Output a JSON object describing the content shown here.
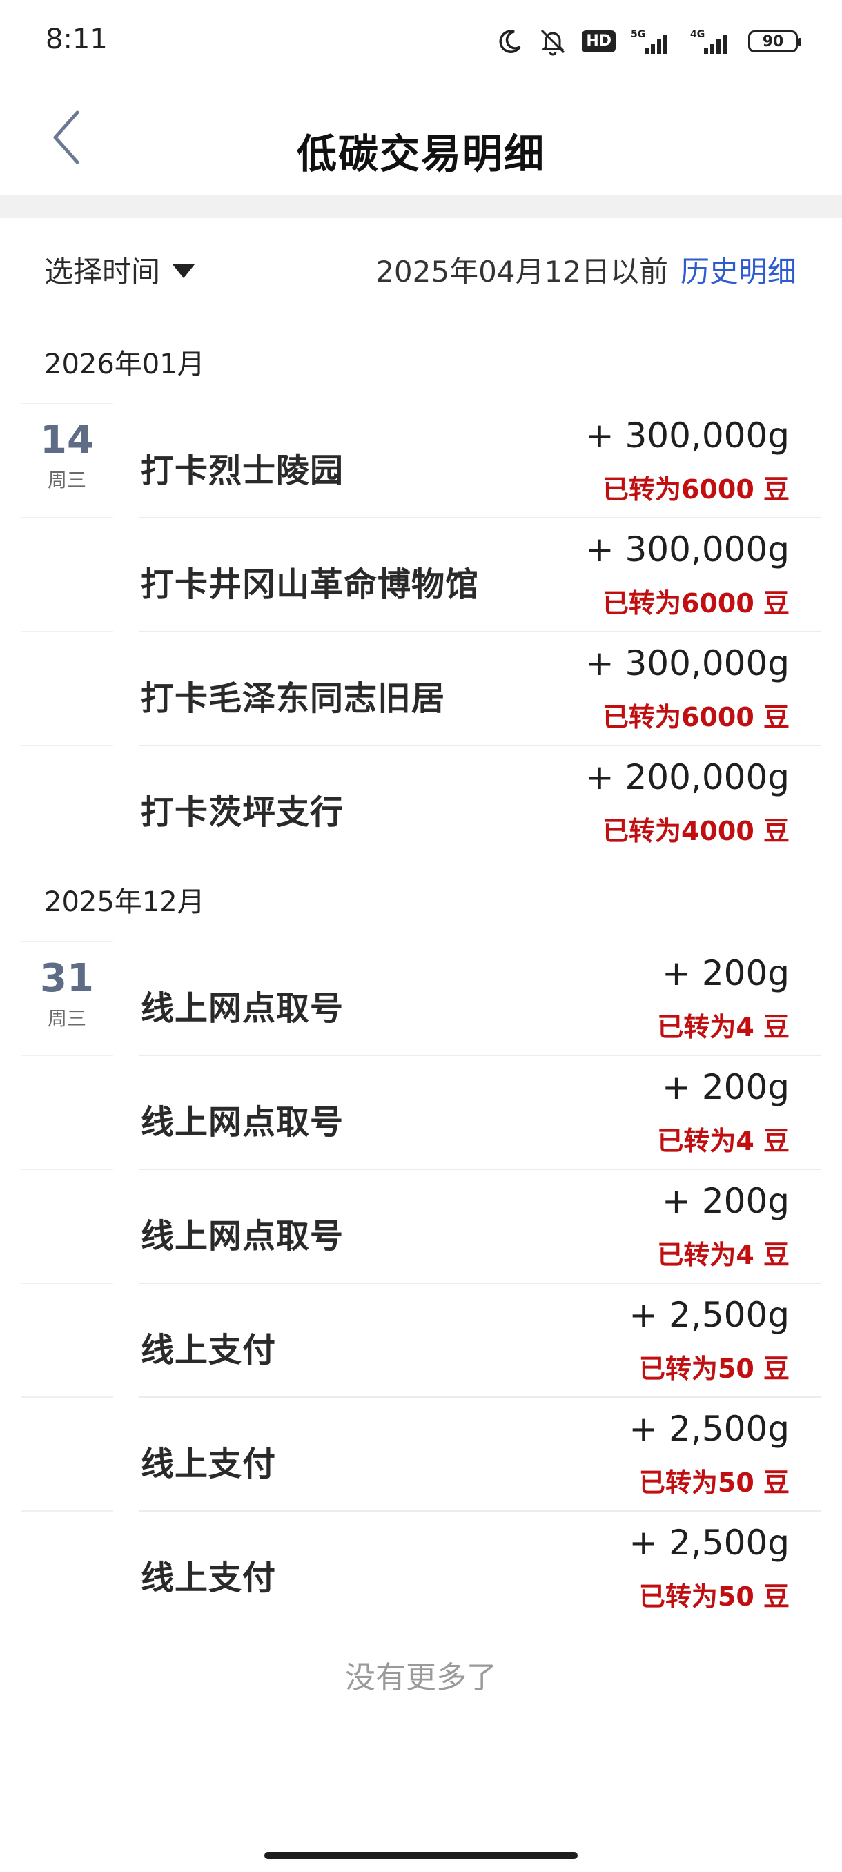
{
  "status_bar": {
    "time": "8:11",
    "icons": [
      "moon-icon",
      "bell-off-icon",
      "hd-icon",
      "signal-5g-icon",
      "signal-4g-icon",
      "battery-icon"
    ],
    "hd_text": "HD",
    "signal_5g": "5G",
    "signal_4g": "4G",
    "battery": "90"
  },
  "header": {
    "back_icon": "chevron-left-icon",
    "title": "低碳交易明细"
  },
  "filter": {
    "select_label": "选择时间",
    "before_date": "2025年04月12日以前",
    "history_link": "历史明细"
  },
  "colors": {
    "accent_link": "#2f5bd0",
    "converted_red": "#c10e10",
    "day_number": "#5f6c86"
  },
  "groups": [
    {
      "month": "2026年01月",
      "day": "14",
      "weekday": "周三",
      "items": [
        {
          "title": "打卡烈士陵园",
          "amount": "+ 300,000g",
          "note": "已转为6000 豆"
        },
        {
          "title": "打卡井冈山革命博物馆",
          "amount": "+ 300,000g",
          "note": "已转为6000 豆"
        },
        {
          "title": "打卡毛泽东同志旧居",
          "amount": "+ 300,000g",
          "note": "已转为6000 豆"
        },
        {
          "title": "打卡茨坪支行",
          "amount": "+ 200,000g",
          "note": "已转为4000 豆"
        }
      ]
    },
    {
      "month": "2025年12月",
      "day": "31",
      "weekday": "周三",
      "items": [
        {
          "title": "线上网点取号",
          "amount": "+ 200g",
          "note": "已转为4 豆"
        },
        {
          "title": "线上网点取号",
          "amount": "+ 200g",
          "note": "已转为4 豆"
        },
        {
          "title": "线上网点取号",
          "amount": "+ 200g",
          "note": "已转为4 豆"
        },
        {
          "title": "线上支付",
          "amount": "+ 2,500g",
          "note": "已转为50 豆"
        },
        {
          "title": "线上支付",
          "amount": "+ 2,500g",
          "note": "已转为50 豆"
        },
        {
          "title": "线上支付",
          "amount": "+ 2,500g",
          "note": "已转为50 豆"
        }
      ]
    }
  ],
  "footer": {
    "no_more": "没有更多了"
  }
}
